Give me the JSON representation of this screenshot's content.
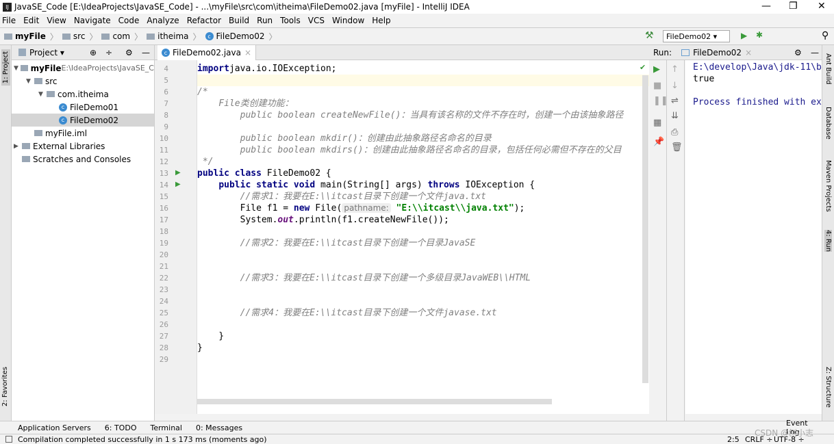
{
  "window": {
    "title": "JavaSE_Code [E:\\IdeaProjects\\JavaSE_Code] - ...\\myFile\\src\\com\\itheima\\FileDemo02.java [myFile] - IntelliJ IDEA",
    "minimize": "—",
    "restore": "❐",
    "close": "✕"
  },
  "menu": [
    "File",
    "Edit",
    "View",
    "Navigate",
    "Code",
    "Analyze",
    "Refactor",
    "Build",
    "Run",
    "Tools",
    "VCS",
    "Window",
    "Help"
  ],
  "breadcrumb": [
    "myFile",
    "src",
    "com",
    "itheima",
    "FileDemo02"
  ],
  "run_config": "FileDemo02 ▾",
  "left_tabs": {
    "project": "1: Project",
    "favorites": "2: Favorites"
  },
  "right_tabs": {
    "ant": "Ant Build",
    "database": "Database",
    "maven": "Maven Projects",
    "run": "4: Run",
    "structure": "Z: Structure"
  },
  "project": {
    "header": "Project ▾",
    "tree": [
      {
        "label": "myFile",
        "extra": " E:\\IdeaProjects\\JavaSE_C",
        "indent": 0,
        "arrow": "▼",
        "icon": "folder",
        "bold": true
      },
      {
        "label": "src",
        "indent": 1,
        "arrow": "▼",
        "icon": "folder"
      },
      {
        "label": "com.itheima",
        "indent": 2,
        "arrow": "▼",
        "icon": "folder"
      },
      {
        "label": "FileDemo01",
        "indent": 3,
        "arrow": "",
        "icon": "class"
      },
      {
        "label": "FileDemo02",
        "indent": 3,
        "arrow": "",
        "icon": "class",
        "selected": true
      },
      {
        "label": "myFile.iml",
        "indent": 1,
        "arrow": "",
        "icon": "file"
      },
      {
        "label": "External Libraries",
        "indent": 0,
        "arrow": "▶",
        "icon": "lib"
      },
      {
        "label": "Scratches and Consoles",
        "indent": 0,
        "arrow": "",
        "icon": "scratch"
      }
    ]
  },
  "editor": {
    "tab": "FileDemo02.java",
    "lines": [
      {
        "n": "4",
        "t": [
          [
            "kw",
            "import"
          ],
          [
            "",
            "java.io.IOException;"
          ]
        ],
        "x": 0
      },
      {
        "n": "5",
        "t": [],
        "current": true
      },
      {
        "n": "6",
        "t": [
          [
            "cm",
            "/*"
          ]
        ]
      },
      {
        "n": "7",
        "t": [
          [
            "cm",
            "    File类创建功能："
          ]
        ]
      },
      {
        "n": "8",
        "t": [
          [
            "cm",
            "        public boolean createNewFile()：当具有该名称的文件不存在时，创建一个由该抽象路径"
          ]
        ]
      },
      {
        "n": "9",
        "t": []
      },
      {
        "n": "10",
        "t": [
          [
            "cm",
            "        public boolean mkdir()：创建由此抽象路径名命名的目录"
          ]
        ]
      },
      {
        "n": "11",
        "t": [
          [
            "cm",
            "        public boolean mkdirs()：创建由此抽象路径名命名的目录，包括任何必需但不存在的父目"
          ]
        ]
      },
      {
        "n": "12",
        "t": [
          [
            "cm",
            " */"
          ]
        ]
      },
      {
        "n": "13",
        "t": [
          [
            "kw",
            "public class "
          ],
          [
            "",
            "FileDemo02 {"
          ]
        ],
        "run": true
      },
      {
        "n": "14",
        "t": [
          [
            "",
            "    "
          ],
          [
            "kw",
            "public static void "
          ],
          [
            "",
            "main(String[] args) "
          ],
          [
            "kw",
            "throws "
          ],
          [
            "",
            "IOException {"
          ]
        ],
        "run": true
      },
      {
        "n": "15",
        "t": [
          [
            "cm",
            "        //需求1：我要在E:\\\\itcast目录下创建一个文件java.txt"
          ]
        ]
      },
      {
        "n": "16",
        "t": [
          [
            "",
            "        File f1 = "
          ],
          [
            "kw",
            "new "
          ],
          [
            "",
            "File("
          ],
          [
            "hint",
            "pathname:"
          ],
          [
            "st",
            " \"E:\\\\itcast\\\\java.txt\""
          ],
          [
            "",
            ");"
          ]
        ]
      },
      {
        "n": "17",
        "t": [
          [
            "",
            "        System."
          ],
          [
            "it",
            "out"
          ],
          [
            "",
            ".println(f1.createNewFile());"
          ]
        ]
      },
      {
        "n": "18",
        "t": []
      },
      {
        "n": "19",
        "t": [
          [
            "cm",
            "        //需求2：我要在E:\\\\itcast目录下创建一个目录JavaSE"
          ]
        ]
      },
      {
        "n": "20",
        "t": []
      },
      {
        "n": "21",
        "t": []
      },
      {
        "n": "22",
        "t": [
          [
            "cm",
            "        //需求3：我要在E:\\\\itcast目录下创建一个多级目录JavaWEB\\\\HTML"
          ]
        ]
      },
      {
        "n": "23",
        "t": []
      },
      {
        "n": "24",
        "t": []
      },
      {
        "n": "25",
        "t": [
          [
            "cm",
            "        //需求4：我要在E:\\\\itcast目录下创建一个文件javase.txt"
          ]
        ]
      },
      {
        "n": "26",
        "t": []
      },
      {
        "n": "27",
        "t": [
          [
            "",
            "    }"
          ]
        ]
      },
      {
        "n": "28",
        "t": [
          [
            "",
            "}"
          ]
        ]
      },
      {
        "n": "29",
        "t": []
      }
    ]
  },
  "run": {
    "label": "Run:",
    "tab": "FileDemo02",
    "console": [
      "E:\\develop\\Java\\jdk-11\\b",
      "true",
      "",
      "Process finished with ex"
    ]
  },
  "bottom_tools": [
    "Application Servers",
    "6: TODO",
    "Terminal",
    "0: Messages"
  ],
  "event_log": "Event Log",
  "status": {
    "message": "Compilation completed successfully in 1 s 173 ms (moments ago)",
    "position": "2:5",
    "line_sep": "CRLF ÷",
    "encoding": "UTF-8 ÷"
  },
  "watermark": "CSDN @刨小志"
}
